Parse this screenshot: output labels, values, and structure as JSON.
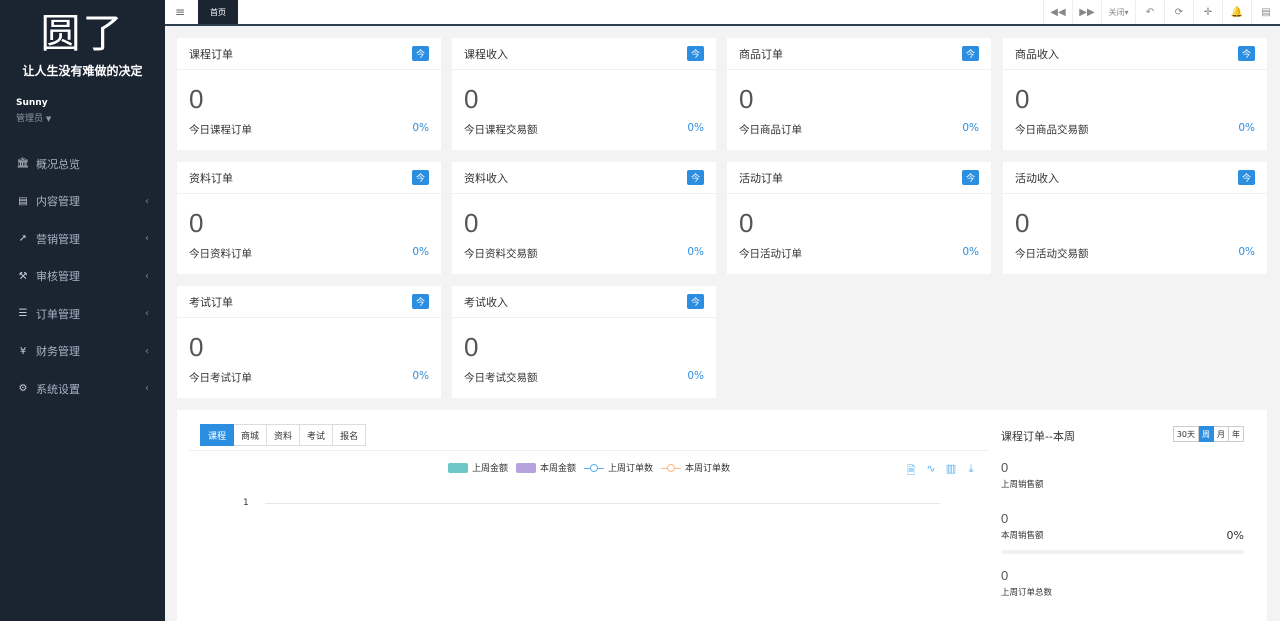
{
  "sidebar": {
    "logo_text": "圆了",
    "slogan": "让人生没有难做的决定",
    "user_name": "Sunny",
    "user_role": "管理员",
    "items": [
      {
        "label": "概况总览",
        "icon": "bank-icon",
        "has_arrow": false
      },
      {
        "label": "内容管理",
        "icon": "newspaper-icon",
        "has_arrow": true
      },
      {
        "label": "营销管理",
        "icon": "paper-plane-icon",
        "has_arrow": true
      },
      {
        "label": "审核管理",
        "icon": "gavel-icon",
        "has_arrow": true
      },
      {
        "label": "订单管理",
        "icon": "list-icon",
        "has_arrow": true
      },
      {
        "label": "财务管理",
        "icon": "yen-icon",
        "has_arrow": true
      },
      {
        "label": "系统设置",
        "icon": "gear-icon",
        "has_arrow": true
      }
    ]
  },
  "topbar": {
    "active_tab": "首页",
    "close_label": "关闭"
  },
  "cards": [
    {
      "title": "课程订单",
      "badge": "今",
      "value": "0",
      "label": "今日课程订单",
      "pct": "0%"
    },
    {
      "title": "课程收入",
      "badge": "今",
      "value": "0",
      "label": "今日课程交易额",
      "pct": "0%"
    },
    {
      "title": "商品订单",
      "badge": "今",
      "value": "0",
      "label": "今日商品订单",
      "pct": "0%"
    },
    {
      "title": "商品收入",
      "badge": "今",
      "value": "0",
      "label": "今日商品交易额",
      "pct": "0%"
    },
    {
      "title": "资料订单",
      "badge": "今",
      "value": "0",
      "label": "今日资料订单",
      "pct": "0%"
    },
    {
      "title": "资料收入",
      "badge": "今",
      "value": "0",
      "label": "今日资料交易额",
      "pct": "0%"
    },
    {
      "title": "活动订单",
      "badge": "今",
      "value": "0",
      "label": "今日活动订单",
      "pct": "0%"
    },
    {
      "title": "活动收入",
      "badge": "今",
      "value": "0",
      "label": "今日活动交易额",
      "pct": "0%"
    },
    {
      "title": "考试订单",
      "badge": "今",
      "value": "0",
      "label": "今日考试订单",
      "pct": "0%"
    },
    {
      "title": "考试收入",
      "badge": "今",
      "value": "0",
      "label": "今日考试交易额",
      "pct": "0%"
    }
  ],
  "panel": {
    "tabs": [
      "课程",
      "商城",
      "资料",
      "考试",
      "报名"
    ],
    "legend": [
      {
        "label": "上周金额",
        "color": "#6cc8c8"
      },
      {
        "label": "本周金额",
        "color": "#b6a2de"
      },
      {
        "label": "上周订单数",
        "color": "#5ab1ef"
      },
      {
        "label": "本周订单数",
        "color": "#ffb980"
      }
    ],
    "y_tick": "1",
    "side_title": "课程订单--本周",
    "ranges": [
      "30天",
      "周",
      "月",
      "年"
    ],
    "stats": [
      {
        "value": "0",
        "label": "上周销售额",
        "pct": ""
      },
      {
        "value": "0",
        "label": "本周销售额",
        "pct": "0%"
      },
      {
        "value": "0",
        "label": "上周订单总数",
        "pct": ""
      }
    ],
    "progress": 0
  }
}
